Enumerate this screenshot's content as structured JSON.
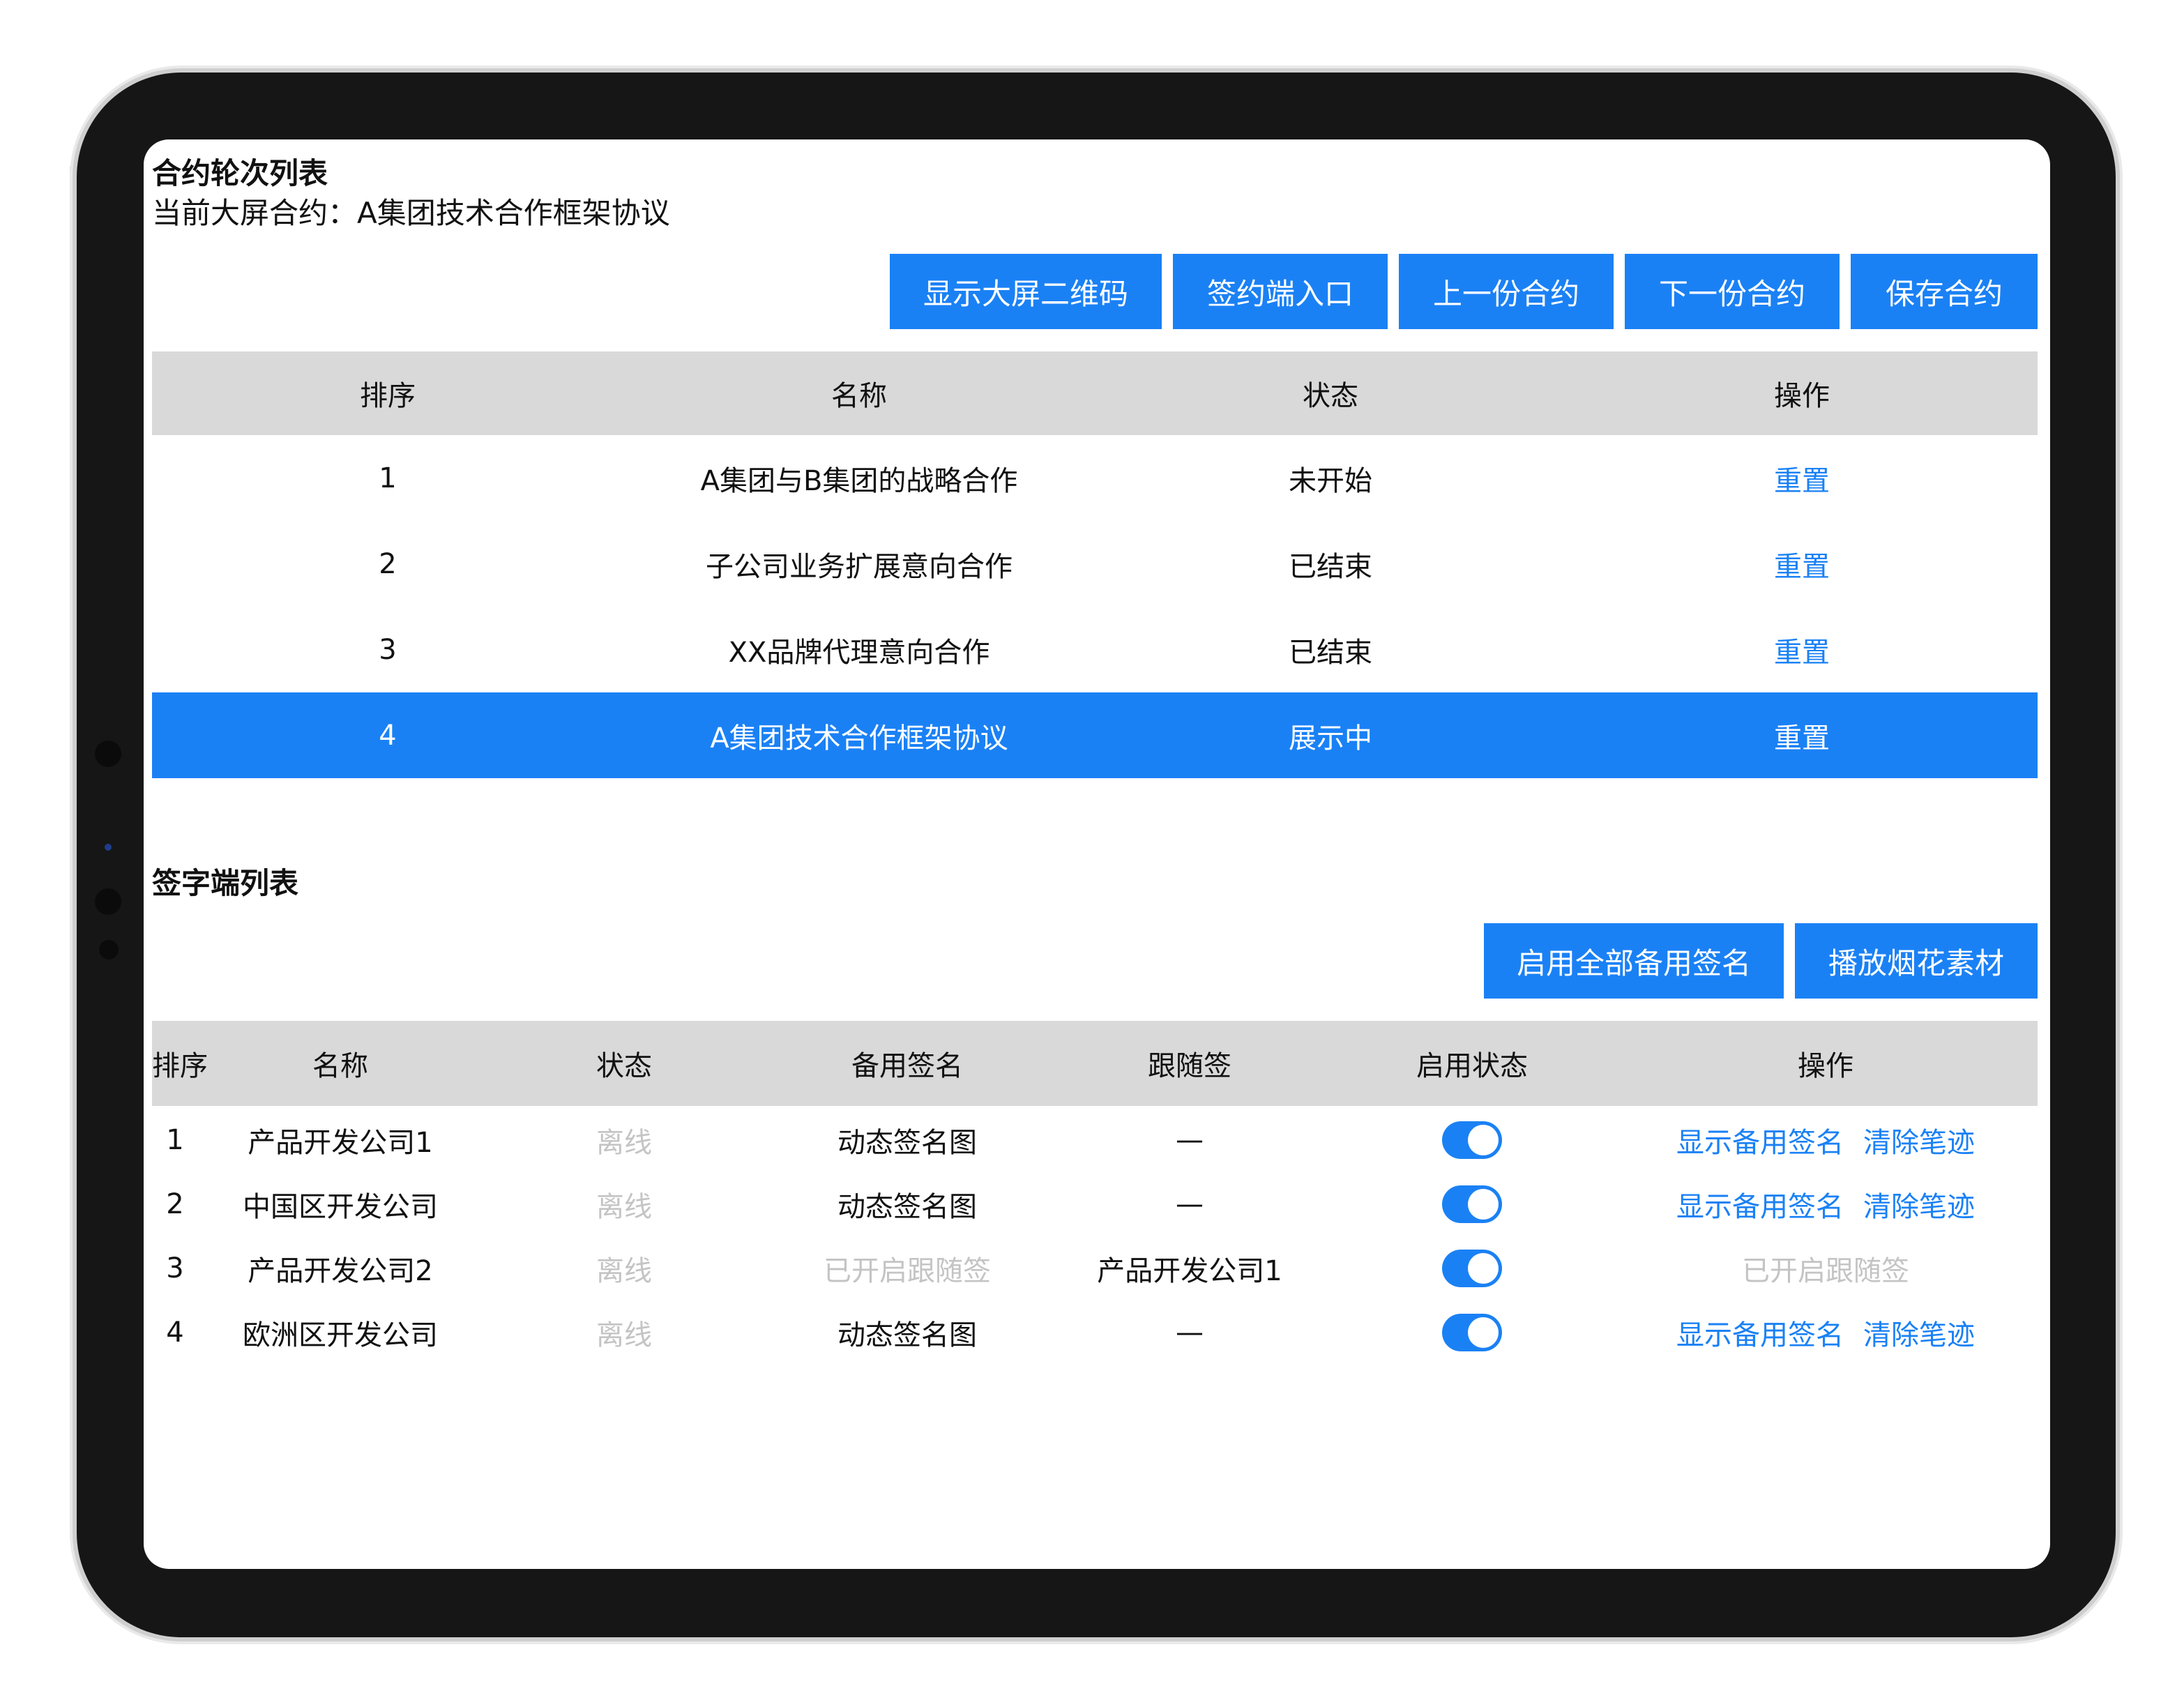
{
  "section1": {
    "title": "合约轮次列表",
    "current_label": "当前大屏合约：A集团技术合作框架协议",
    "buttons": [
      "显示大屏二维码",
      "签约端入口",
      "上一份合约",
      "下一份合约",
      "保存合约"
    ],
    "table": {
      "headers": [
        "排序",
        "名称",
        "状态",
        "操作"
      ],
      "rows": [
        {
          "order": "1",
          "name": "A集团与B集团的战略合作",
          "status": "未开始",
          "action": "重置"
        },
        {
          "order": "2",
          "name": "子公司业务扩展意向合作",
          "status": "已结束",
          "action": "重置"
        },
        {
          "order": "3",
          "name": "XX品牌代理意向合作",
          "status": "已结束",
          "action": "重置"
        },
        {
          "order": "4",
          "name": "A集团技术合作框架协议",
          "status": "展示中",
          "action": "重置"
        }
      ],
      "active_row": 4
    }
  },
  "section2": {
    "title": "签字端列表",
    "buttons": [
      "启用全部备用签名",
      "播放烟花素材"
    ],
    "table": {
      "headers": [
        "排序",
        "名称",
        "状态",
        "备用签名",
        "跟随签",
        "启用状态",
        "操作"
      ],
      "rows": [
        {
          "order": "1",
          "name": "产品开发公司1",
          "status": "离线",
          "backup": "动态签名图",
          "follow": "—",
          "enabled": true,
          "action1": "显示备用签名",
          "action2": "清除笔迹"
        },
        {
          "order": "2",
          "name": "中国区开发公司",
          "status": "离线",
          "backup": "动态签名图",
          "follow": "—",
          "enabled": true,
          "action1": "显示备用签名",
          "action2": "清除笔迹"
        },
        {
          "order": "3",
          "name": "产品开发公司2",
          "status": "离线",
          "backup": "已开启跟随签",
          "follow": "产品开发公司1",
          "enabled": true,
          "action_disabled": "已开启跟随签"
        },
        {
          "order": "4",
          "name": "欧洲区开发公司",
          "status": "离线",
          "backup": "动态签名图",
          "follow": "—",
          "enabled": true,
          "action1": "显示备用签名",
          "action2": "清除笔迹"
        }
      ]
    }
  },
  "colors": {
    "accent": "#1a81f5",
    "header_bg": "#d9d9d9",
    "muted_text": "#c4c4c4",
    "device_frame": "#161616"
  }
}
